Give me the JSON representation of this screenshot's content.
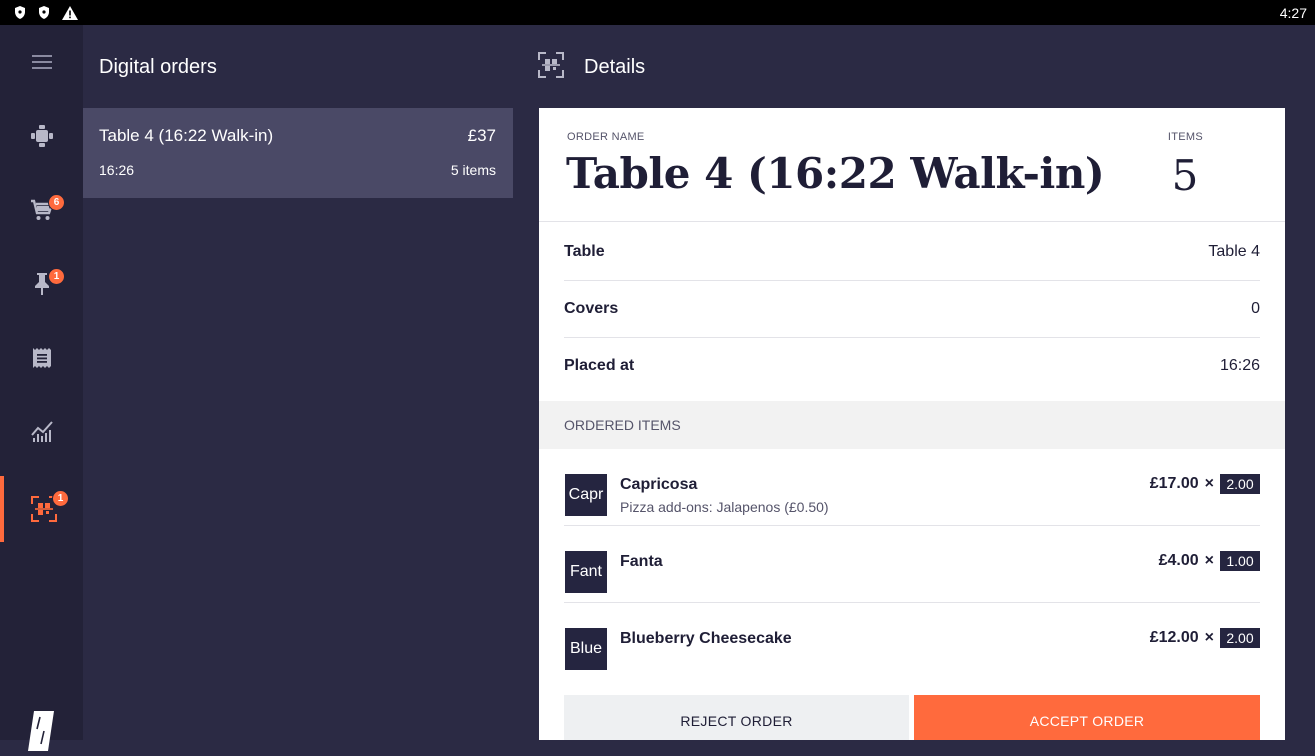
{
  "status": {
    "time": "4:27",
    "icons": [
      "shield-icon",
      "shield-icon",
      "warning-icon"
    ]
  },
  "nav": {
    "items": [
      {
        "icon": "menu-icon"
      },
      {
        "icon": "table-icon"
      },
      {
        "icon": "cart-icon",
        "badge": "6"
      },
      {
        "icon": "pin-icon",
        "badge": "1"
      },
      {
        "icon": "receipt-icon"
      },
      {
        "icon": "analytics-icon"
      },
      {
        "icon": "qr-scan-icon",
        "badge": "1",
        "active": true
      }
    ],
    "accent": "#ff6a3d"
  },
  "list": {
    "title": "Digital orders",
    "orders": [
      {
        "name": "Table 4 (16:22 Walk-in)",
        "price": "£37",
        "time": "16:26",
        "count": "5 items"
      }
    ]
  },
  "details": {
    "title": "Details",
    "order_name_label": "ORDER NAME",
    "order_name": "Table 4 (16:22 Walk-in)",
    "items_label": "ITEMS",
    "items_count": "5",
    "rows": [
      {
        "label": "Table",
        "value": "Table 4"
      },
      {
        "label": "Covers",
        "value": "0"
      },
      {
        "label": "Placed at",
        "value": "16:26"
      }
    ],
    "section_label": "ORDERED ITEMS",
    "items": [
      {
        "thumb": "Capr",
        "name": "Capricosa",
        "sub": "Pizza add-ons: Jalapenos (£0.50)",
        "price": "£17.00",
        "times": "×",
        "qty": "2.00"
      },
      {
        "thumb": "Fant",
        "name": "Fanta",
        "sub": "",
        "price": "£4.00",
        "times": "×",
        "qty": "1.00"
      },
      {
        "thumb": "Blue",
        "name": "Blueberry Cheesecake",
        "sub": "",
        "price": "£12.00",
        "times": "×",
        "qty": "2.00"
      }
    ],
    "reject_label": "REJECT ORDER",
    "accept_label": "ACCEPT ORDER"
  }
}
